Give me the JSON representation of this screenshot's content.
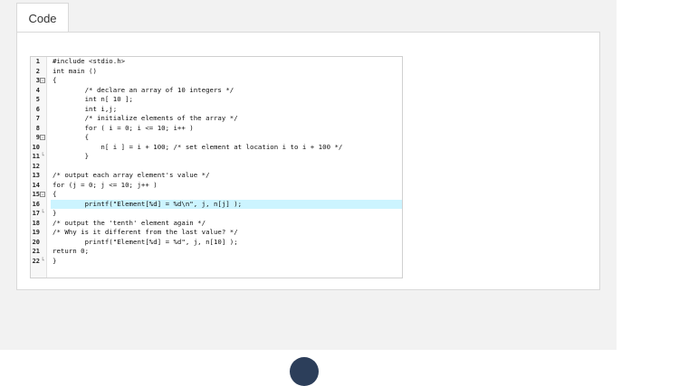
{
  "tab": {
    "label": "Code"
  },
  "code_lines": [
    {
      "n": "1",
      "fold": "",
      "text": "#include <stdio.h>",
      "hl": false
    },
    {
      "n": "2",
      "fold": "",
      "text": "int main ()",
      "hl": false
    },
    {
      "n": "3",
      "fold": "box",
      "text": "{",
      "hl": false
    },
    {
      "n": "4",
      "fold": "",
      "text": "        /* declare an array of 10 integers */",
      "hl": false
    },
    {
      "n": "5",
      "fold": "",
      "text": "        int n[ 10 ];",
      "hl": false
    },
    {
      "n": "6",
      "fold": "",
      "text": "        int i,j;",
      "hl": false
    },
    {
      "n": "7",
      "fold": "",
      "text": "        /* initialize elements of the array */",
      "hl": false
    },
    {
      "n": "8",
      "fold": "",
      "text": "        for ( i = 0; i <= 10; i++ )",
      "hl": false
    },
    {
      "n": "9",
      "fold": "box",
      "text": "        {",
      "hl": false
    },
    {
      "n": "10",
      "fold": "",
      "text": "            n[ i ] = i + 100; /* set element at location i to i + 100 */",
      "hl": false
    },
    {
      "n": "11",
      "fold": "end",
      "text": "        }",
      "hl": false
    },
    {
      "n": "12",
      "fold": "",
      "text": "",
      "hl": false
    },
    {
      "n": "13",
      "fold": "",
      "text": "/* output each array element's value */",
      "hl": false
    },
    {
      "n": "14",
      "fold": "",
      "text": "for (j = 0; j <= 10; j++ )",
      "hl": false
    },
    {
      "n": "15",
      "fold": "box",
      "text": "{",
      "hl": false
    },
    {
      "n": "16",
      "fold": "",
      "text": "        printf(\"Element[%d] = %d\\n\", j, n[j] );",
      "hl": true
    },
    {
      "n": "17",
      "fold": "end",
      "text": "}",
      "hl": false
    },
    {
      "n": "18",
      "fold": "",
      "text": "/* output the 'tenth' element again */",
      "hl": false
    },
    {
      "n": "19",
      "fold": "",
      "text": "/* Why is it different from the last value? */",
      "hl": false
    },
    {
      "n": "20",
      "fold": "",
      "text": "        printf(\"Element[%d] = %d\", j, n[10] );",
      "hl": false
    },
    {
      "n": "21",
      "fold": "",
      "text": "return 0;",
      "hl": false
    },
    {
      "n": "22",
      "fold": "end",
      "text": "}",
      "hl": false
    }
  ],
  "colors": {
    "highlight": "#ccf4ff",
    "panel_bg": "#f2f2f2"
  }
}
